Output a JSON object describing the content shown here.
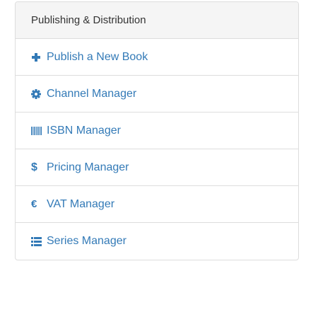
{
  "panel": {
    "title": "Publishing & Distribution",
    "items": [
      {
        "label": "Publish a New Book",
        "icon": "plus-icon"
      },
      {
        "label": "Channel Manager",
        "icon": "gear-icon"
      },
      {
        "label": "ISBN Manager",
        "icon": "barcode-icon"
      },
      {
        "label": "Pricing Manager",
        "icon": "dollar-icon"
      },
      {
        "label": "VAT Manager",
        "icon": "euro-icon"
      },
      {
        "label": "Series Manager",
        "icon": "list-icon"
      }
    ]
  },
  "colors": {
    "link": "#337ab7",
    "heading_bg": "#f5f5f5",
    "border": "#dddddd",
    "heading_text": "#333333"
  }
}
